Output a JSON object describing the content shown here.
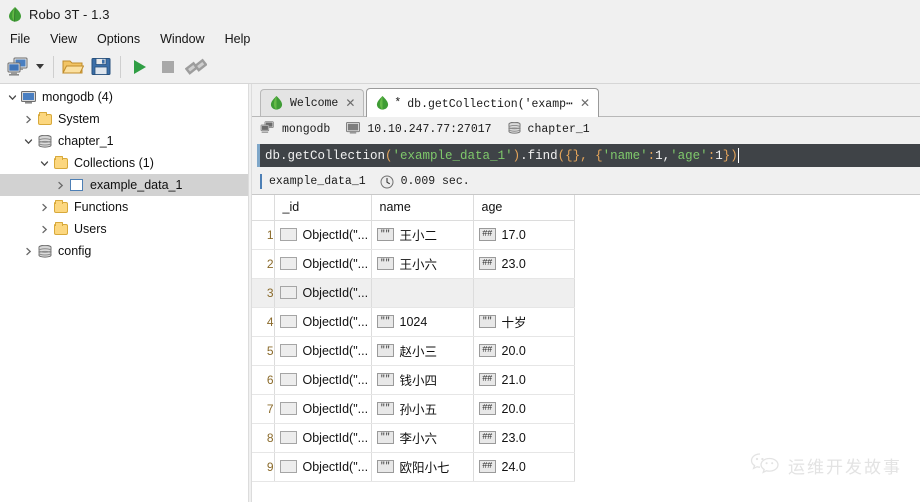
{
  "window": {
    "title": "Robo 3T - 1.3",
    "logo_icon": "robo-leaf-icon"
  },
  "menubar": {
    "items": [
      {
        "label": "File"
      },
      {
        "label": "View"
      },
      {
        "label": "Options"
      },
      {
        "label": "Window"
      },
      {
        "label": "Help"
      }
    ]
  },
  "toolbar": {
    "items": [
      {
        "name": "connect-button",
        "icon": "computer-connect-icon"
      },
      {
        "name": "connect-dropdown",
        "icon": "chevron-down-icon"
      },
      {
        "name": "open-script-button",
        "icon": "folder-open-icon"
      },
      {
        "name": "save-script-button",
        "icon": "floppy-save-icon"
      },
      {
        "name": "execute-button",
        "icon": "play-green-icon"
      },
      {
        "name": "stop-button",
        "icon": "stop-square-icon"
      },
      {
        "name": "disconnect-button",
        "icon": "broken-link-icon"
      }
    ]
  },
  "sidebar": {
    "nodes": [
      {
        "label": "mongodb (4)",
        "icon": "computer-icon",
        "depth": 0,
        "expander": "down",
        "selected": false
      },
      {
        "label": "System",
        "icon": "folder-icon",
        "depth": 1,
        "expander": "right",
        "selected": false
      },
      {
        "label": "chapter_1",
        "icon": "database-icon",
        "depth": 1,
        "expander": "down",
        "selected": false
      },
      {
        "label": "Collections (1)",
        "icon": "folder-icon",
        "depth": 2,
        "expander": "down",
        "selected": false
      },
      {
        "label": "example_data_1",
        "icon": "collection-grid-icon",
        "depth": 3,
        "expander": "right",
        "selected": true
      },
      {
        "label": "Functions",
        "icon": "folder-icon",
        "depth": 2,
        "expander": "right",
        "selected": false
      },
      {
        "label": "Users",
        "icon": "folder-icon",
        "depth": 2,
        "expander": "right",
        "selected": false
      },
      {
        "label": "config",
        "icon": "database-icon",
        "depth": 1,
        "expander": "right",
        "selected": false
      }
    ]
  },
  "tabs": [
    {
      "label": "Welcome",
      "icon": "robo-leaf-icon",
      "active": false,
      "modified": false,
      "close_icon": "close-icon"
    },
    {
      "label": "db.getCollection('examp⋯",
      "icon": "mongo-leaf-icon",
      "active": true,
      "modified": true,
      "modified_marker": "*",
      "close_icon": "close-icon"
    }
  ],
  "connection_info": {
    "server_label": "mongodb",
    "server_icon": "server-icon",
    "host_label": "10.10.247.77:27017",
    "host_icon": "computer-icon",
    "database_label": "chapter_1",
    "database_icon": "database-icon"
  },
  "editor": {
    "tokens": [
      {
        "text": "db.getCollection",
        "kind": "plain"
      },
      {
        "text": "(",
        "kind": "punct"
      },
      {
        "text": "'example_data_1'",
        "kind": "string"
      },
      {
        "text": ")",
        "kind": "punct"
      },
      {
        "text": ".find",
        "kind": "plain"
      },
      {
        "text": "({}, {",
        "kind": "punct"
      },
      {
        "text": "'name'",
        "kind": "string"
      },
      {
        "text": ":",
        "kind": "punct"
      },
      {
        "text": " 1, ",
        "kind": "plain"
      },
      {
        "text": "'age'",
        "kind": "string"
      },
      {
        "text": ":",
        "kind": "punct"
      },
      {
        "text": " 1",
        "kind": "plain"
      },
      {
        "text": "})",
        "kind": "punct"
      }
    ],
    "plain_text": "db.getCollection('example_data_1').find({}, {'name': 1, 'age': 1})"
  },
  "results": {
    "collection_label": "example_data_1",
    "collection_icon": "collection-grid-icon",
    "time_icon": "clock-icon",
    "time_label": "0.009 sec.",
    "columns": [
      "_id",
      "name",
      "age"
    ],
    "rows": [
      {
        "num": "1",
        "id": "ObjectId(\"...",
        "id_type": "oid",
        "name": "王小二",
        "name_type": "string",
        "age": "17.0",
        "age_type": "number",
        "empty": false
      },
      {
        "num": "2",
        "id": "ObjectId(\"...",
        "id_type": "oid",
        "name": "王小六",
        "name_type": "string",
        "age": "23.0",
        "age_type": "number",
        "empty": false
      },
      {
        "num": "3",
        "id": "ObjectId(\"...",
        "id_type": "oid",
        "name": "",
        "name_type": "none",
        "age": "",
        "age_type": "none",
        "empty": true
      },
      {
        "num": "4",
        "id": "ObjectId(\"...",
        "id_type": "oid",
        "name": "1024",
        "name_type": "string",
        "age": "十岁",
        "age_type": "string",
        "empty": false
      },
      {
        "num": "5",
        "id": "ObjectId(\"...",
        "id_type": "oid",
        "name": "赵小三",
        "name_type": "string",
        "age": "20.0",
        "age_type": "number",
        "empty": false
      },
      {
        "num": "6",
        "id": "ObjectId(\"...",
        "id_type": "oid",
        "name": "钱小四",
        "name_type": "string",
        "age": "21.0",
        "age_type": "number",
        "empty": false
      },
      {
        "num": "7",
        "id": "ObjectId(\"...",
        "id_type": "oid",
        "name": "孙小五",
        "name_type": "string",
        "age": "20.0",
        "age_type": "number",
        "empty": false
      },
      {
        "num": "8",
        "id": "ObjectId(\"...",
        "id_type": "oid",
        "name": "李小六",
        "name_type": "string",
        "age": "23.0",
        "age_type": "number",
        "empty": false
      },
      {
        "num": "9",
        "id": "ObjectId(\"...",
        "id_type": "oid",
        "name": "欧阳小七",
        "name_type": "string",
        "age": "24.0",
        "age_type": "number",
        "empty": false
      }
    ],
    "type_badges": {
      "string": "\"\"",
      "number": "##",
      "oid": ""
    }
  },
  "watermark": {
    "text": "运维开发故事",
    "icon": "wechat-icon"
  },
  "colors": {
    "accent_green": "#2f9e44",
    "editor_bg": "#3f4347",
    "editor_string": "#7fc96b",
    "editor_punct": "#e5a55a",
    "editor_text": "#f2f2f2",
    "selection": "#d2d2d2",
    "rownum": "#8a6a2a",
    "watermark": "#e3e3e3"
  }
}
